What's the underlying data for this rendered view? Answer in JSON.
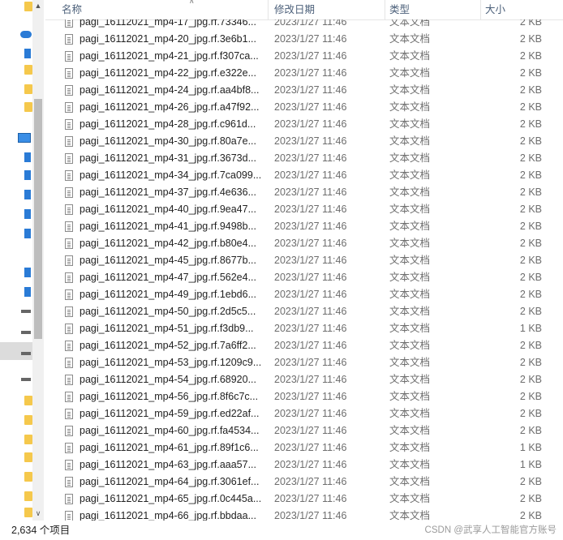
{
  "header": {
    "name": "名称",
    "date": "修改日期",
    "type": "类型",
    "size": "大小"
  },
  "partial_row": {
    "name": "pagi_16112021_mp4-17_jpg.rf.73346...",
    "date": "2023/1/27 11:46",
    "type": "文本文档",
    "size": "2 KB"
  },
  "files": [
    {
      "name": "pagi_16112021_mp4-20_jpg.rf.3e6b1...",
      "date": "2023/1/27 11:46",
      "type": "文本文档",
      "size": "2 KB"
    },
    {
      "name": "pagi_16112021_mp4-21_jpg.rf.f307ca...",
      "date": "2023/1/27 11:46",
      "type": "文本文档",
      "size": "2 KB"
    },
    {
      "name": "pagi_16112021_mp4-22_jpg.rf.e322e...",
      "date": "2023/1/27 11:46",
      "type": "文本文档",
      "size": "2 KB"
    },
    {
      "name": "pagi_16112021_mp4-24_jpg.rf.aa4bf8...",
      "date": "2023/1/27 11:46",
      "type": "文本文档",
      "size": "2 KB"
    },
    {
      "name": "pagi_16112021_mp4-26_jpg.rf.a47f92...",
      "date": "2023/1/27 11:46",
      "type": "文本文档",
      "size": "2 KB"
    },
    {
      "name": "pagi_16112021_mp4-28_jpg.rf.c961d...",
      "date": "2023/1/27 11:46",
      "type": "文本文档",
      "size": "2 KB"
    },
    {
      "name": "pagi_16112021_mp4-30_jpg.rf.80a7e...",
      "date": "2023/1/27 11:46",
      "type": "文本文档",
      "size": "2 KB"
    },
    {
      "name": "pagi_16112021_mp4-31_jpg.rf.3673d...",
      "date": "2023/1/27 11:46",
      "type": "文本文档",
      "size": "2 KB"
    },
    {
      "name": "pagi_16112021_mp4-34_jpg.rf.7ca099...",
      "date": "2023/1/27 11:46",
      "type": "文本文档",
      "size": "2 KB"
    },
    {
      "name": "pagi_16112021_mp4-37_jpg.rf.4e636...",
      "date": "2023/1/27 11:46",
      "type": "文本文档",
      "size": "2 KB"
    },
    {
      "name": "pagi_16112021_mp4-40_jpg.rf.9ea47...",
      "date": "2023/1/27 11:46",
      "type": "文本文档",
      "size": "2 KB"
    },
    {
      "name": "pagi_16112021_mp4-41_jpg.rf.9498b...",
      "date": "2023/1/27 11:46",
      "type": "文本文档",
      "size": "2 KB"
    },
    {
      "name": "pagi_16112021_mp4-42_jpg.rf.b80e4...",
      "date": "2023/1/27 11:46",
      "type": "文本文档",
      "size": "2 KB"
    },
    {
      "name": "pagi_16112021_mp4-45_jpg.rf.8677b...",
      "date": "2023/1/27 11:46",
      "type": "文本文档",
      "size": "2 KB"
    },
    {
      "name": "pagi_16112021_mp4-47_jpg.rf.562e4...",
      "date": "2023/1/27 11:46",
      "type": "文本文档",
      "size": "2 KB"
    },
    {
      "name": "pagi_16112021_mp4-49_jpg.rf.1ebd6...",
      "date": "2023/1/27 11:46",
      "type": "文本文档",
      "size": "2 KB"
    },
    {
      "name": "pagi_16112021_mp4-50_jpg.rf.2d5c5...",
      "date": "2023/1/27 11:46",
      "type": "文本文档",
      "size": "2 KB"
    },
    {
      "name": "pagi_16112021_mp4-51_jpg.rf.f3db9...",
      "date": "2023/1/27 11:46",
      "type": "文本文档",
      "size": "1 KB"
    },
    {
      "name": "pagi_16112021_mp4-52_jpg.rf.7a6ff2...",
      "date": "2023/1/27 11:46",
      "type": "文本文档",
      "size": "2 KB"
    },
    {
      "name": "pagi_16112021_mp4-53_jpg.rf.1209c9...",
      "date": "2023/1/27 11:46",
      "type": "文本文档",
      "size": "2 KB"
    },
    {
      "name": "pagi_16112021_mp4-54_jpg.rf.68920...",
      "date": "2023/1/27 11:46",
      "type": "文本文档",
      "size": "2 KB"
    },
    {
      "name": "pagi_16112021_mp4-56_jpg.rf.8f6c7c...",
      "date": "2023/1/27 11:46",
      "type": "文本文档",
      "size": "2 KB"
    },
    {
      "name": "pagi_16112021_mp4-59_jpg.rf.ed22af...",
      "date": "2023/1/27 11:46",
      "type": "文本文档",
      "size": "2 KB"
    },
    {
      "name": "pagi_16112021_mp4-60_jpg.rf.fa4534...",
      "date": "2023/1/27 11:46",
      "type": "文本文档",
      "size": "2 KB"
    },
    {
      "name": "pagi_16112021_mp4-61_jpg.rf.89f1c6...",
      "date": "2023/1/27 11:46",
      "type": "文本文档",
      "size": "1 KB"
    },
    {
      "name": "pagi_16112021_mp4-63_jpg.rf.aaa57...",
      "date": "2023/1/27 11:46",
      "type": "文本文档",
      "size": "1 KB"
    },
    {
      "name": "pagi_16112021_mp4-64_jpg.rf.3061ef...",
      "date": "2023/1/27 11:46",
      "type": "文本文档",
      "size": "2 KB"
    },
    {
      "name": "pagi_16112021_mp4-65_jpg.rf.0c445a...",
      "date": "2023/1/27 11:46",
      "type": "文本文档",
      "size": "2 KB"
    },
    {
      "name": "pagi_16112021_mp4-66_jpg.rf.bbdaa...",
      "date": "2023/1/27 11:46",
      "type": "文本文档",
      "size": "2 KB"
    }
  ],
  "status": {
    "count": "2,634 个项目",
    "watermark": "CSDN @武享人工智能官方账号"
  },
  "icons": {
    "file": "text-file-icon",
    "scroll_up": "chevron-up-icon",
    "scroll_down": "chevron-down-icon",
    "sort": "sort-arrow-icon"
  }
}
